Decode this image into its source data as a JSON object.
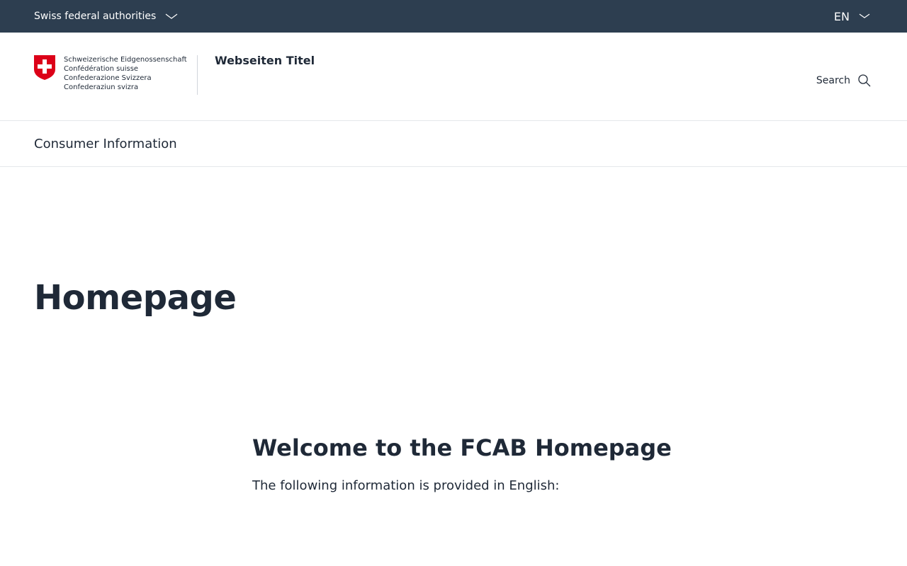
{
  "topbar": {
    "authorities_label": "Swiss federal authorities",
    "language": "EN",
    "background_color": "#2d3e50"
  },
  "header": {
    "logo_lines": [
      "Schweizerische Eidgenossenschaft",
      "Confédération suisse",
      "Confederazione Svizzera",
      "Confederaziun svizra"
    ],
    "site_title": "Webseiten Titel",
    "search_label": "Search",
    "flag_color": "#dc0018"
  },
  "nav": {
    "items": [
      {
        "label": "Consumer Information"
      }
    ]
  },
  "hero": {
    "title": "Homepage"
  },
  "content": {
    "heading": "Welcome to the FCAB Homepage",
    "intro": "The following information is provided in English:"
  }
}
